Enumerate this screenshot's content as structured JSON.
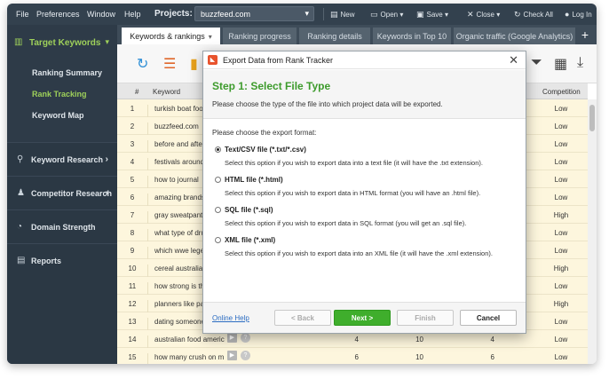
{
  "menu": {
    "file": "File",
    "preferences": "Preferences",
    "window": "Window",
    "help": "Help",
    "projects_label": "Projects:",
    "project_value": "buzzfeed.com",
    "toolbar": {
      "new": "New",
      "open": "Open",
      "save": "Save",
      "close": "Close",
      "check_all": "Check All",
      "log_in": "Log In"
    }
  },
  "sidebar": {
    "target_keywords": "Target Keywords",
    "sub_items": [
      "Ranking Summary",
      "Rank Tracking",
      "Keyword Map"
    ],
    "sections": [
      "Keyword Research",
      "Competitor Research",
      "Domain Strength",
      "Reports"
    ]
  },
  "tabs": [
    "Keywords & rankings",
    "Ranking progress",
    "Ranking details",
    "Keywords in Top 10",
    "Organic traffic (Google Analytics)"
  ],
  "table": {
    "headers": {
      "num": "#",
      "keyword": "Keyword",
      "competition": "Competition"
    },
    "rows": [
      {
        "num": "1",
        "keyword": "turkish boat food",
        "competition": "Low"
      },
      {
        "num": "2",
        "keyword": "buzzfeed.com",
        "competition": "Low"
      },
      {
        "num": "3",
        "keyword": "before and after",
        "competition": "Low"
      },
      {
        "num": "4",
        "keyword": "festivals around the",
        "competition": "Low"
      },
      {
        "num": "5",
        "keyword": "how to journal",
        "competition": "Low"
      },
      {
        "num": "6",
        "keyword": "amazing brands",
        "competition": "Low"
      },
      {
        "num": "7",
        "keyword": "gray sweatpants",
        "competition": "High"
      },
      {
        "num": "8",
        "keyword": "what type of dru",
        "competition": "Low"
      },
      {
        "num": "9",
        "keyword": "which wwe lege",
        "competition": "Low"
      },
      {
        "num": "10",
        "keyword": "cereal australia",
        "competition": "High"
      },
      {
        "num": "11",
        "keyword": "how strong is th",
        "competition": "Low"
      },
      {
        "num": "12",
        "keyword": "planners like pa",
        "competition": "High"
      },
      {
        "num": "13",
        "keyword": "dating someone",
        "competition": "Low"
      },
      {
        "num": "14",
        "keyword": "australian food americ",
        "v1": "4",
        "v2": "10",
        "v3": "4",
        "competition": "Low"
      },
      {
        "num": "15",
        "keyword": "how many crush on m",
        "v1": "6",
        "v2": "10",
        "v3": "6",
        "competition": "Low"
      }
    ]
  },
  "dialog": {
    "title": "Export Data from Rank Tracker",
    "step": "Step 1: Select File Type",
    "description": "Please choose the type of the file into which project data will be exported.",
    "prompt": "Please choose the export format:",
    "options": [
      {
        "name": "Text/CSV file (*.txt/*.csv)",
        "help": "Select this option if you wish to export data into a text file (it will have the .txt extension)."
      },
      {
        "name": "HTML file (*.html)",
        "help": "Select this option if you wish to export data in HTML format (you will have an .html file)."
      },
      {
        "name": "SQL file (*.sql)",
        "help": "Select this option if you wish to export data in SQL format (you will get an .sql file)."
      },
      {
        "name": "XML file (*.xml)",
        "help": "Select this option if you wish to export data into an XML file (it will have the .xml extension)."
      }
    ],
    "online_help": "Online Help",
    "back": "< Back",
    "next": "Next >",
    "finish": "Finish",
    "cancel": "Cancel"
  },
  "colors": {
    "accent_green": "#3fae2c",
    "sidebar_active": "#9ed05a",
    "menubar": "#33414e"
  }
}
